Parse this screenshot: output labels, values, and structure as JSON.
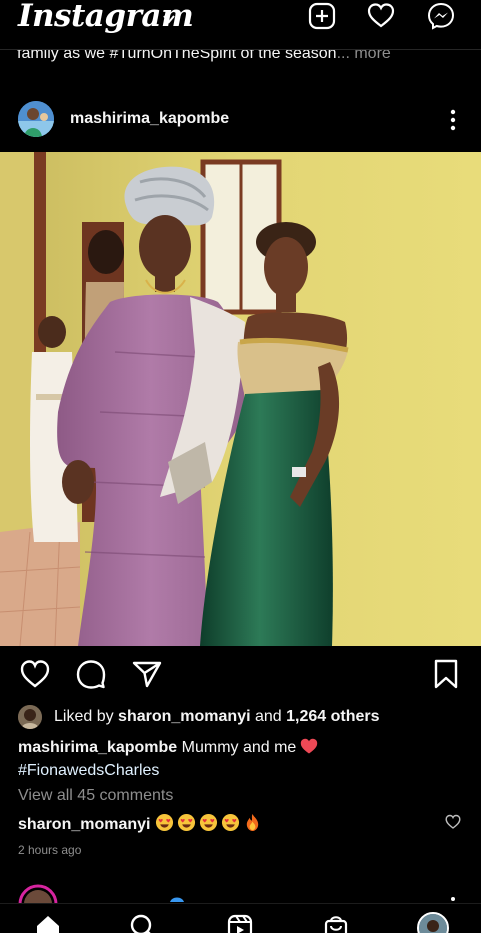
{
  "header": {
    "brand": "Instagram",
    "icons": [
      "chevron-down-icon",
      "new-post-icon",
      "activity-heart-icon",
      "messenger-icon"
    ]
  },
  "previous_post": {
    "caption_text": "family as we #TurnOnTheSpirit of the season",
    "more_label": "... more"
  },
  "post": {
    "username": "mashirima_kapombe",
    "liked_by": {
      "prefix": "Liked by ",
      "user": "sharon_momanyi",
      "middle": " and ",
      "count": "1,264 others"
    },
    "caption": {
      "username": "mashirima_kapombe",
      "text": " Mummy and me",
      "hashtag": "#FionawedsCharles"
    },
    "view_comments": "View all 45 comments",
    "comment": {
      "username": "sharon_momanyi"
    },
    "timestamp": "2 hours ago"
  },
  "bottom_nav": {
    "icons": [
      "home-icon",
      "search-icon",
      "reels-icon",
      "shop-icon",
      "profile-avatar"
    ]
  },
  "colors": {
    "background": "#000000",
    "text": "#f5f5f5",
    "muted": "#8e8e8e",
    "heart_red": "#ed4956"
  }
}
